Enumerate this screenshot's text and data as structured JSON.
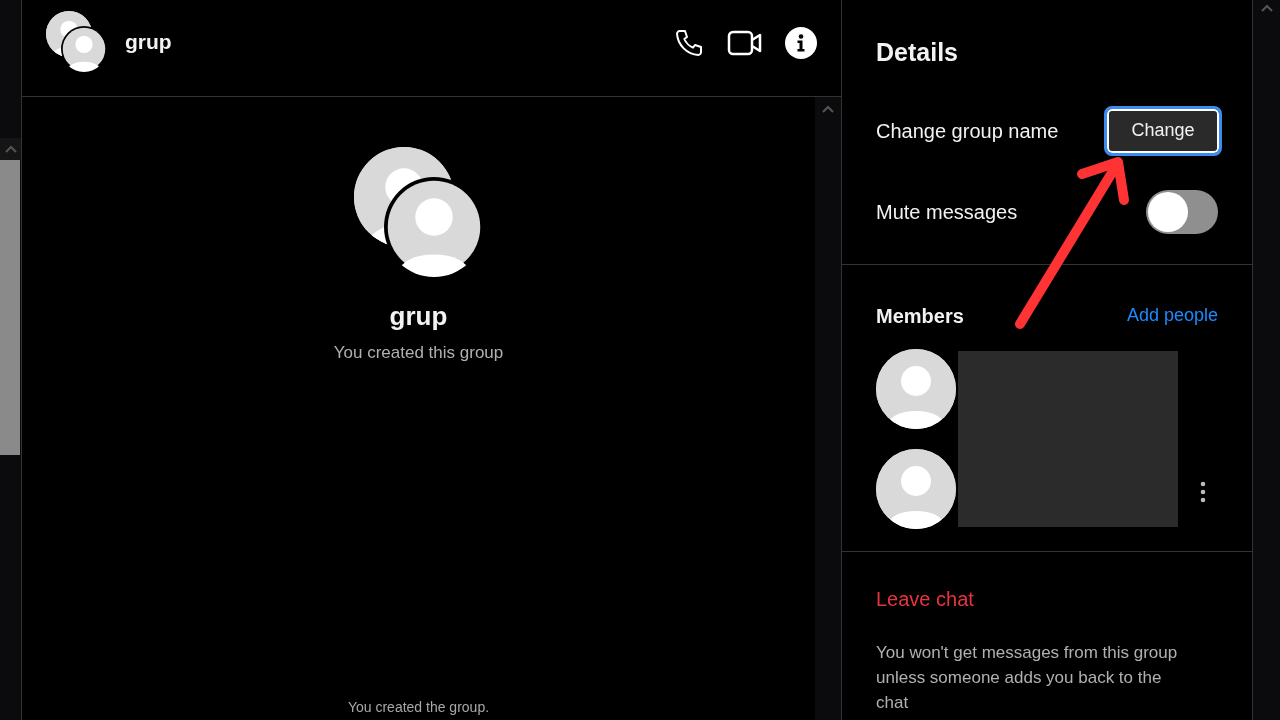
{
  "chat_header": {
    "title": "grup"
  },
  "conversation": {
    "title": "grup",
    "subtitle": "You created this group",
    "system_message": "You created the group."
  },
  "details": {
    "title": "Details",
    "change_name": {
      "label": "Change group name",
      "button": "Change"
    },
    "mute": {
      "label": "Mute messages",
      "on": false
    },
    "members": {
      "title": "Members",
      "add_link": "Add people"
    },
    "leave": {
      "label": "Leave chat",
      "note": "You won't get messages from this group unless someone adds you back to the chat"
    }
  }
}
